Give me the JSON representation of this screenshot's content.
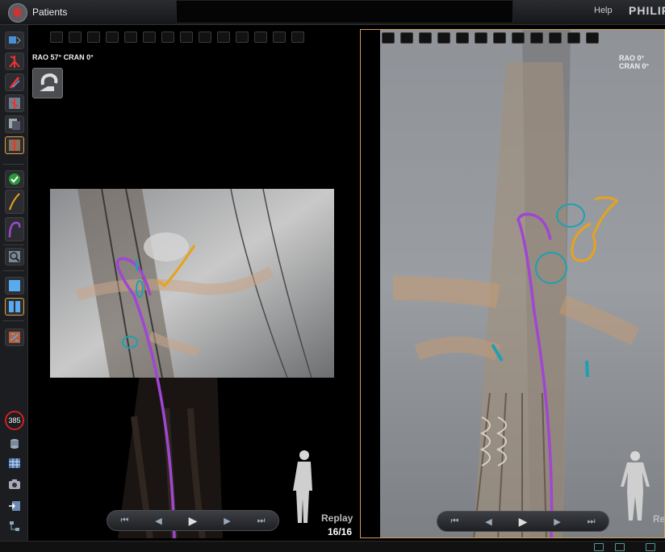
{
  "app": {
    "title": "Patients",
    "help_label": "Help",
    "brand": "PHILIPS"
  },
  "left_view": {
    "geometry": "RAO  57° CRAN  0°",
    "replay_label": "Replay",
    "frame_counter": "16/16"
  },
  "right_view": {
    "geometry": "RAO  0° CRAN  0°",
    "replay_label": "Re"
  },
  "sidebar": {
    "dose_badge": "385"
  },
  "colors": {
    "accent_border": "#d39b55",
    "catheter": "#a046d2",
    "guidewire": "#e8a21c",
    "marker": "#1ea0b0"
  }
}
